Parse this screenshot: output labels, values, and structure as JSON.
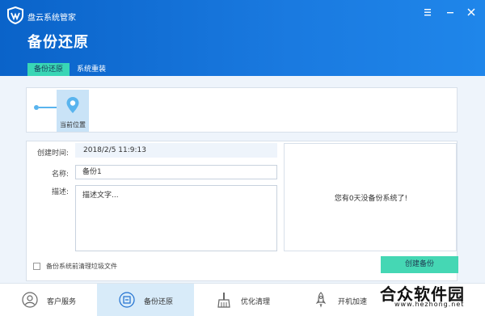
{
  "header": {
    "app_title": "盘云系统管家",
    "page_title": "备份还原",
    "tabs": [
      {
        "label": "备份还原",
        "active": true
      },
      {
        "label": "系统重装",
        "active": false
      }
    ],
    "window_controls": [
      "menu-icon",
      "minimize-icon",
      "close-icon"
    ]
  },
  "timeline": {
    "current_label": "当前位置"
  },
  "form": {
    "created_label": "创建时间:",
    "created_value": "2018/2/5  11:9:13",
    "name_label": "名称:",
    "name_value": "备份1",
    "desc_label": "描述:",
    "desc_placeholder": "描述文字...",
    "notice": "您有0天没备份系统了!",
    "cleanup_checkbox_label": "备份系统前清理垃圾文件",
    "cleanup_checked": false,
    "create_button": "创建备份"
  },
  "bottom_nav": [
    {
      "label": "客户服务",
      "icon": "customer-service-icon",
      "active": false
    },
    {
      "label": "备份还原",
      "icon": "backup-restore-icon",
      "active": true
    },
    {
      "label": "优化清理",
      "icon": "cleanup-brush-icon",
      "active": false
    },
    {
      "label": "开机加速",
      "icon": "rocket-icon",
      "active": false
    }
  ],
  "watermark": {
    "text": "合众软件园",
    "url": "www.hezhong.net"
  },
  "colors": {
    "header_blue": "#0a63c9",
    "accent_teal": "#39d6b5",
    "button_teal": "#45d7b4",
    "timeline_blue": "#59b4ee",
    "content_bg": "#eef4fb"
  }
}
